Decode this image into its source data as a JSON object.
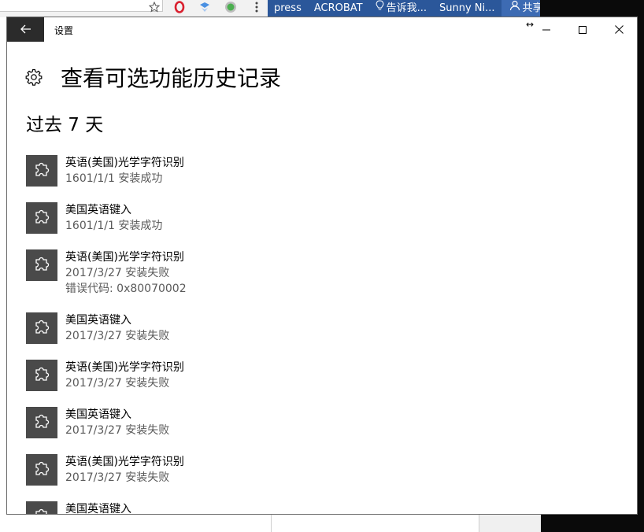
{
  "background": {
    "chrome_icons": [
      "star-icon",
      "opera-icon",
      "extension-icon",
      "extension-icon",
      "menu-dots-icon"
    ],
    "office_tabs": [
      "press",
      "ACROBAT",
      "告诉我...",
      "Sunny Ni..."
    ],
    "share_label": "共享"
  },
  "window": {
    "title": "设置",
    "resize_glyph": "↔"
  },
  "page": {
    "title": "查看可选功能历史记录",
    "section": "过去 7 天"
  },
  "history": [
    {
      "name": "英语(美国)光学字符识别",
      "lines": [
        "1601/1/1 安装成功"
      ]
    },
    {
      "name": "美国英语键入",
      "lines": [
        "1601/1/1 安装成功"
      ]
    },
    {
      "name": "英语(美国)光学字符识别",
      "lines": [
        "2017/3/27 安装失败",
        "错误代码: 0x80070002"
      ]
    },
    {
      "name": "美国英语键入",
      "lines": [
        "2017/3/27 安装失败"
      ]
    },
    {
      "name": "英语(美国)光学字符识别",
      "lines": [
        "2017/3/27 安装失败"
      ]
    },
    {
      "name": "美国英语键入",
      "lines": [
        "2017/3/27 安装失败"
      ]
    },
    {
      "name": "英语(美国)光学字符识别",
      "lines": [
        "2017/3/27 安装失败"
      ]
    },
    {
      "name": "美国英语键入",
      "lines": []
    }
  ],
  "colors": {
    "tile": "#4a4a4a",
    "back_button": "#2b2b2b",
    "office_bar": "#2b579a"
  }
}
